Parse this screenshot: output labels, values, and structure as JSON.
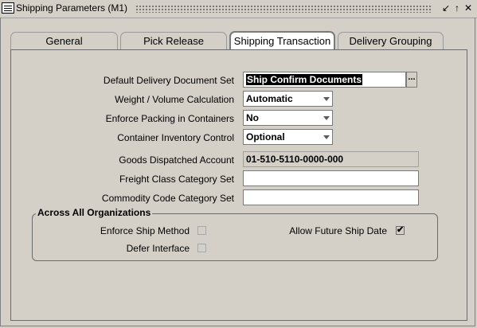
{
  "window": {
    "title": "Shipping Parameters (M1)",
    "controls": {
      "minimize": "↙",
      "maximize": "↑",
      "close": "✕"
    }
  },
  "tabs": [
    {
      "label": "General",
      "active": false
    },
    {
      "label": "Pick Release",
      "active": false
    },
    {
      "label": "Shipping Transaction",
      "active": true
    },
    {
      "label": "Delivery Grouping",
      "active": false
    }
  ],
  "form": {
    "default_delivery_document_set": {
      "label": "Default Delivery Document Set",
      "value": "Ship Confirm Documents",
      "lov_icon": "..."
    },
    "weight_volume_calculation": {
      "label": "Weight / Volume Calculation",
      "value": "Automatic"
    },
    "enforce_packing": {
      "label": "Enforce Packing in Containers",
      "value": "No"
    },
    "container_inventory_control": {
      "label": "Container Inventory Control",
      "value": "Optional"
    },
    "goods_dispatched_account": {
      "label": "Goods Dispatched Account",
      "value": "01-510-5110-0000-000"
    },
    "freight_class_category_set": {
      "label": "Freight Class Category Set",
      "value": ""
    },
    "commodity_code_category_set": {
      "label": "Commodity Code Category Set",
      "value": ""
    }
  },
  "across_all_orgs": {
    "title": "Across All Organizations",
    "enforce_ship_method": {
      "label": "Enforce Ship Method",
      "checked": false
    },
    "defer_interface": {
      "label": "Defer Interface",
      "checked": false
    },
    "allow_future_ship_date": {
      "label": "Allow Future Ship Date",
      "checked": true,
      "mark": "✔"
    }
  }
}
